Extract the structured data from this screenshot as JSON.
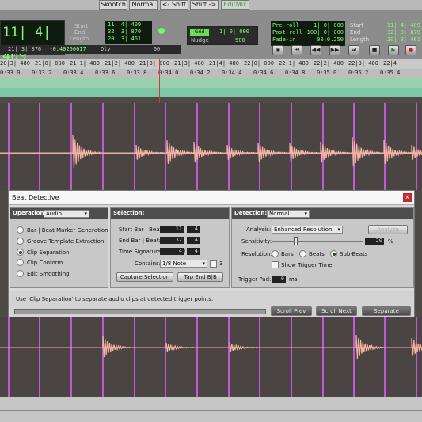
{
  "modes": [
    "Skootch",
    "Normal",
    "<- Shift",
    "Shift ->",
    "EditMix"
  ],
  "counter": {
    "main": "11| 4| 409",
    "start_label": "Start",
    "end_label": "End",
    "length_label": "Length",
    "start": "11| 4| 409",
    "end": "32| 3| 870",
    "length": "20| 3| 461",
    "cursor": "21| 3| 876",
    "value": "-0.40260017",
    "dly": "Dly",
    "zero": "00"
  },
  "grid": {
    "label": "Grid",
    "value": "1| 0| 000",
    "nudge_label": "Nudge",
    "nudge_value": "500"
  },
  "prepost": {
    "preroll_label": "Pre-roll",
    "postroll_label": "Post-roll",
    "fadein_label": "Fade-in",
    "preroll": "1| 0| 000",
    "postroll": "100| 0| 000",
    "fadein": "00:0.250",
    "start_label": "Start",
    "end_label": "End",
    "length_label": "Length",
    "start": "11| 4| 409",
    "end": "32| 3| 870",
    "length": "20| 3| 461"
  },
  "transport_icons": [
    "online-icon",
    "rewind-icon",
    "fast-rewind-icon",
    "fast-forward-icon",
    "go-to-end-icon",
    "stop-icon",
    "play-icon",
    "record-icon"
  ],
  "bars_ruler": [
    "20|3| 480",
    "21|0| 000",
    "21|1| 480",
    "21|2| 480",
    "21|3| 000",
    "21|3| 480",
    "21|4| 480",
    "22|0| 000",
    "22|1| 480",
    "22|2| 480",
    "22|3| 480",
    "22|4"
  ],
  "time_ruler": [
    "0:33.0",
    "0:33.2",
    "0:33.4",
    "0:33.6",
    "0:33.8",
    "0:34.0",
    "0:34.2",
    "0:34.4",
    "0:34.6",
    "0:34.8",
    "0:35.0",
    "0:35.2",
    "0:35.4"
  ],
  "dialog": {
    "title": "Beat Detective",
    "close": "x",
    "operation_label": "Operation:",
    "operation_value": "Audio",
    "operations": [
      "Bar | Beat Marker Generation",
      "Groove Template Extraction",
      "Clip Separation",
      "Clip Conform",
      "Edit Smoothing"
    ],
    "selection_label": "Selection:",
    "start_label": "Start Bar | Beat:",
    "start_bar": "11",
    "start_beat": "4",
    "end_label": "End Bar | Beat:",
    "end_bar": "32",
    "end_beat": "4",
    "timesig_label": "Time Signature:",
    "timesig_num": "4",
    "timesig_den": "4",
    "contains_label": "Contains:",
    "contains_value": "1/8 Note",
    "contains_extra": "3",
    "capture_button": "Capture Selection",
    "tap_button": "Tap End B|B",
    "detection_label": "Detection:",
    "detection_value": "Normal",
    "analysis_label": "Analysis:",
    "analysis_value": "Enhanced Resolution",
    "analyze_button": "Analyze",
    "sensitivity_label": "Sensitivity:",
    "sensitivity_value": "20",
    "sensitivity_unit": "%",
    "resolution_label": "Resolution:",
    "res_bars": "Bars",
    "res_beats": "Beats",
    "res_subbeats": "Sub-Beats",
    "show_trigger": "Show Trigger Time",
    "trigger_pad_label": "Trigger Pad:",
    "trigger_pad_value": "0",
    "trigger_pad_unit": "ms",
    "status": "Use 'Clip Separation' to separate audio clips at detected trigger points.",
    "scroll_prev": "Scroll Prev",
    "scroll_next": "Scroll Next",
    "separate": "Separate"
  }
}
